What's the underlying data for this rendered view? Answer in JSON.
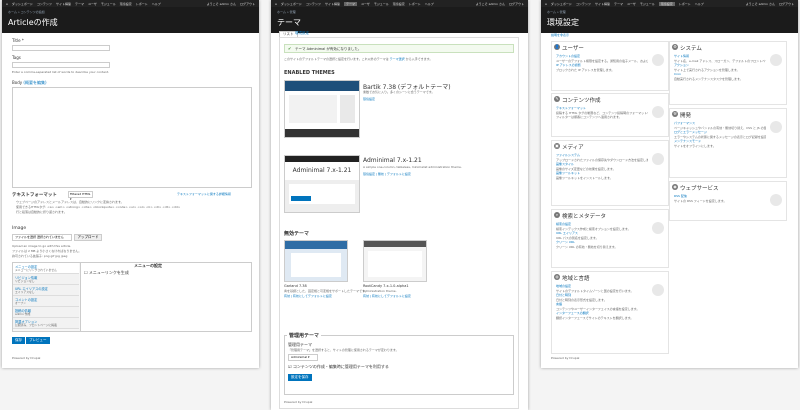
{
  "toolbar": {
    "items": [
      "ダッシュボード",
      "コンテンツ",
      "サイト構築",
      "テーマ",
      "ユーザ",
      "モジュール",
      "環境設定",
      "レポート",
      "ヘルプ"
    ],
    "welcome": "ようこそ admin さん",
    "logout": "ログアウト"
  },
  "article": {
    "breadcrumb": "ホーム » コンテンツの追加",
    "title": "Articleの作成",
    "title_label": "Title *",
    "tags_label": "Tags",
    "tags_help": "Enter a comma-separated list of words to describe your content.",
    "body_label": "Body",
    "body_link": "(概要を編集)",
    "text_format_label": "テキストフォーマット",
    "text_format_value": "Filtered HTML",
    "text_format_link": "テキストフォーマットに関する詳細情報",
    "format_help": [
      "ウェブページのアドレスとメールアドレスは、自動的にリンクに変換されます。",
      "使用できるHTMLタグ: <a> <em> <strong> <cite> <blockquote> <code> <ul> <ol> <li> <dl> <dt> <dd>",
      "行と段落は自動的に折り返されます。"
    ],
    "image_label": "Image",
    "file_choose": "ファイルを選択",
    "file_none": "選択されていません",
    "upload_button": "アップロード",
    "image_help": [
      "Upload an image to go with this article.",
      "ファイルは 2 MB より小さくなければなりません。",
      "許可されている拡張子: png gif jpg jpeg"
    ],
    "vtabs": [
      {
        "title": "メニューの設定",
        "desc": "メニューにリンクされていません"
      },
      {
        "title": "リビジョン情報",
        "desc": "リビジョンなし"
      },
      {
        "title": "URL エイリアスの設定",
        "desc": "エイリアスなし"
      },
      {
        "title": "コメントの設定",
        "desc": "オープン"
      },
      {
        "title": "投稿の情報",
        "desc": "admin 作成"
      },
      {
        "title": "掲載オプション",
        "desc": "公開済み、フロントページに掲載"
      }
    ],
    "menu_settings_title": "メニューの設定",
    "menu_checkbox": "メニューリンクを生成",
    "save_button": "保存",
    "preview_button": "プレビュー",
    "powered": "Powered by Drupal"
  },
  "themes": {
    "breadcrumb": "ホーム » 管理",
    "title": "テーマ",
    "tabs": [
      "リスト",
      "環境設定"
    ],
    "status": "テーマ Adminimal が有効になりました。",
    "description": "このサイトのデフォルトテーマの選択と設定を行います。これ以外のテーマは ",
    "desc_link": "テーマ選択",
    "desc_tail": " から入手できます。",
    "enabled_heading": "ENABLED THEMES",
    "enabled": [
      {
        "name": "Bartik 7.38 (デフォルトテーマ)",
        "desc": "素敵でお気に入り。多くのシーンに合うテーマです。",
        "links": "環境設定"
      },
      {
        "name": "Adminimal 7.x-1.21",
        "desc": "A simple one-column, tableless, minimalist administration theme.",
        "links": "環境設定 | 無効 | デフォルトに設定"
      }
    ],
    "disabled_heading": "無効テーマ",
    "disabled": [
      {
        "name": "Garland 7.38",
        "desc": "青を基調とした、固定幅と可変幅をサポートしたテーマです。",
        "links": "有効 | 有効にしてデフォルトに設定"
      },
      {
        "name": "RootCandy 7.x-1.0-alpha1",
        "desc": "Administration theme.",
        "links": "有効 | 有効にしてデフォルトに設定"
      }
    ],
    "admin_heading": "管理用テーマ",
    "admin_label": "管理用テーマ",
    "admin_help": "「管理用テーマ」を選択すると、サイトの管理に使用されるテーマが変わります。",
    "admin_select": "Adminimal",
    "admin_checkbox": "コンテンツの作成・編集時に管理用テーマを利用する",
    "save_button": "設定を保存",
    "powered": "Powered by Drupal"
  },
  "config": {
    "breadcrumb": "ホーム » 管理",
    "title": "環境設定",
    "hide": "説明を非表示",
    "left": [
      {
        "title": "ユーザー",
        "icon": "user-icon",
        "items": [
          [
            "l",
            "アカウントの設定"
          ],
          [
            "d",
            "ユーザーのデフォルト権限を設定する。通知用の電子メール、および各種フィールドを設定します。"
          ],
          [
            "l",
            "IP アドレスの遮断"
          ],
          [
            "d",
            "ブロックされた IP アドレスを管理します。"
          ]
        ]
      },
      {
        "title": "コンテンツ作成",
        "icon": "pencil-icon",
        "items": [
          [
            "l",
            "テキストフォーマット"
          ],
          [
            "d",
            "投稿する HTML タグの制限など、コンテンツ投稿時のフォーマットを設定します。"
          ],
          [
            "d",
            "フィルターは順番にコンテンツへ適用されます。"
          ]
        ]
      },
      {
        "title": "メディア",
        "icon": "media-icon",
        "items": [
          [
            "l",
            "ファイルシステム"
          ],
          [
            "d",
            "アップロードされたファイルの保存先やダウンロード方法を設定します。"
          ],
          [
            "l",
            "画像スタイル"
          ],
          [
            "d",
            "画像のサイズ変更などの効果を設定します。"
          ],
          [
            "l",
            "画像ツールキット"
          ],
          [
            "d",
            "画像ツールキットをインストールします。"
          ]
        ]
      },
      {
        "title": "検索とメタデータ",
        "icon": "search-icon",
        "items": [
          [
            "l",
            "検索の設定"
          ],
          [
            "d",
            "検索インデックス作成と検索オプションを設定します。"
          ],
          [
            "l",
            "URL エイリアス"
          ],
          [
            "d",
            "URL パスの別名を設定します。"
          ],
          [
            "l",
            "クリーン URL"
          ],
          [
            "d",
            "クリーン URL の有効・無効を切り替えます。"
          ]
        ]
      },
      {
        "title": "地域と言語",
        "icon": "globe-icon",
        "items": [
          [
            "l",
            "地域の設定"
          ],
          [
            "d",
            "サイトのデフォルトタイムゾーンと国の設定を行います。"
          ],
          [
            "l",
            "日付と時刻"
          ],
          [
            "d",
            "日付と時刻の表示形式を設定します。"
          ],
          [
            "l",
            "言語"
          ],
          [
            "d",
            "コンテンツやユーザーインターフェイスの言語を設定します。"
          ],
          [
            "l",
            "インターフェースの翻訳"
          ],
          [
            "d",
            "翻訳インターフェースでサイトのテキストを翻訳します。"
          ]
        ]
      }
    ],
    "right": [
      {
        "title": "システム",
        "icon": "system-icon",
        "items": [
          [
            "l",
            "サイト情報"
          ],
          [
            "d",
            "サイト名、e-mail アドレス、スローガン、デフォルトのフロントページ、ページ数などの基本設定を変更します。"
          ],
          [
            "l",
            "アクション"
          ],
          [
            "d",
            "サイト上で実行されるアクションを管理します。"
          ],
          [
            "l",
            "Cron"
          ],
          [
            "d",
            "自動実行されるメンテナンスタスクを管理します。"
          ]
        ]
      },
      {
        "title": "開発",
        "icon": "wrench-icon",
        "items": [
          [
            "l",
            "パフォーマンス"
          ],
          [
            "d",
            "ページキャッシュやバンドルの有効・無効切り替え、CSS と JS の集約圧縮などを設定します。"
          ],
          [
            "l",
            "ログとエラーメッセージ"
          ],
          [
            "d",
            "エラーやシステムの状態に関するメッセージの表示とログ記録を設定します。"
          ],
          [
            "l",
            "メンテナンスモード"
          ],
          [
            "d",
            "サイトをオフラインにします。"
          ]
        ]
      },
      {
        "title": "ウェブサービス",
        "icon": "rss-icon",
        "items": [
          [
            "l",
            "RSS 配信"
          ],
          [
            "d",
            "サイトの RSS フィードを設定します。"
          ]
        ]
      }
    ],
    "powered": "Powered by Drupal"
  }
}
